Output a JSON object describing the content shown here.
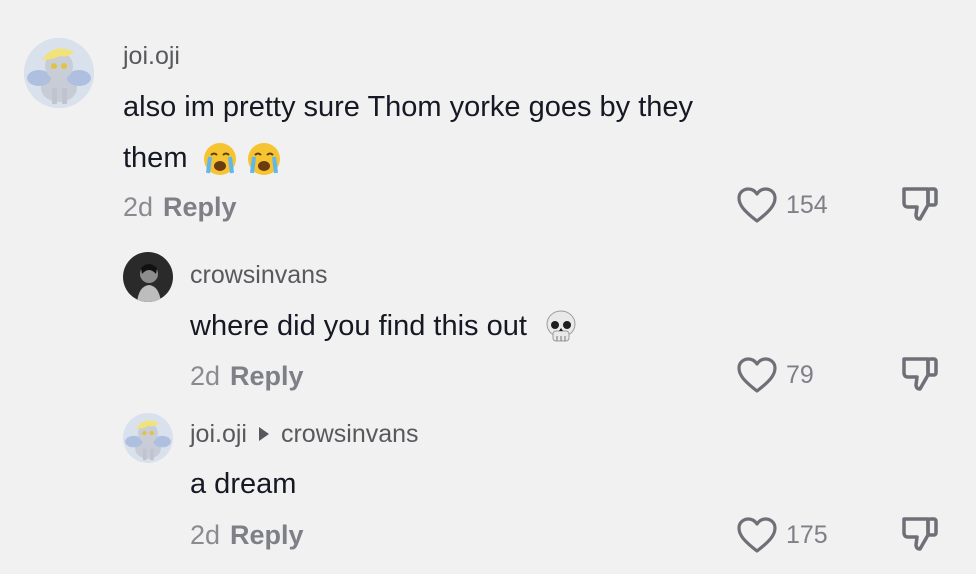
{
  "comments": [
    {
      "username": "joi.oji",
      "text_line1": "also im pretty sure Thom yorke goes by they",
      "text_line2": "them",
      "emojis": [
        "crying-face-emoji",
        "crying-face-emoji"
      ],
      "age": "2d",
      "reply_label": "Reply",
      "likes": "154"
    },
    {
      "username": "crowsinvans",
      "text": "where did you find this out",
      "emojis": [
        "skull-emoji"
      ],
      "age": "2d",
      "reply_label": "Reply",
      "likes": "79"
    },
    {
      "username": "joi.oji",
      "reply_to": "crowsinvans",
      "text": "a dream",
      "age": "2d",
      "reply_label": "Reply",
      "likes": "175"
    }
  ],
  "colors": {
    "background": "#f1f1f2",
    "username": "#58595c",
    "text": "#161823",
    "meta": "#8a8b91"
  }
}
